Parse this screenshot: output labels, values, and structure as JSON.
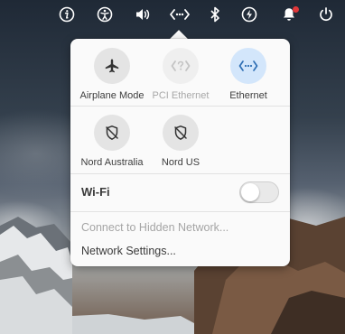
{
  "panel": {
    "icons": [
      {
        "name": "info-icon"
      },
      {
        "name": "accessibility-icon"
      },
      {
        "name": "volume-icon"
      },
      {
        "name": "network-wired-icon"
      },
      {
        "name": "bluetooth-icon"
      },
      {
        "name": "power-saving-icon"
      },
      {
        "name": "notifications-icon"
      },
      {
        "name": "power-icon"
      }
    ],
    "notification_badge_color": "#e0383a"
  },
  "network_popover": {
    "toggles_row1": [
      {
        "label": "Airplane Mode",
        "icon": "airplane-icon",
        "state": "off"
      },
      {
        "label": "PCI Ethernet",
        "icon": "ethernet-unknown-icon",
        "state": "disabled"
      },
      {
        "label": "Ethernet",
        "icon": "ethernet-icon",
        "state": "active"
      }
    ],
    "toggles_row2": [
      {
        "label": "Nord Australia",
        "icon": "vpn-disconnected-icon",
        "state": "off"
      },
      {
        "label": "Nord US",
        "icon": "vpn-disconnected-icon",
        "state": "off"
      }
    ],
    "wifi": {
      "label": "Wi-Fi",
      "enabled": false
    },
    "menu": {
      "connect_hidden": "Connect to Hidden Network...",
      "settings": "Network Settings..."
    },
    "active_color": "#d3e6fb"
  }
}
